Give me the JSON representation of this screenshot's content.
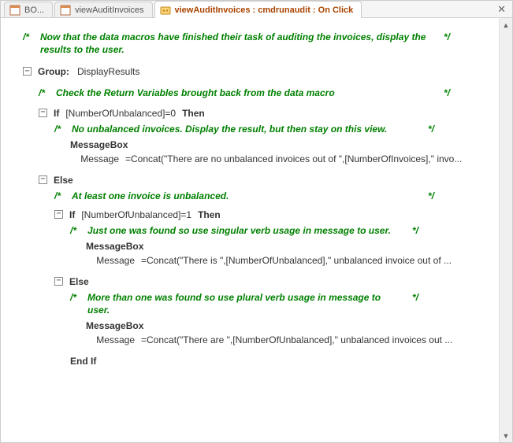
{
  "tabs": {
    "t0": {
      "label": "BO..."
    },
    "t1": {
      "label": "viewAuditInvoices"
    },
    "t2": {
      "label": "viewAuditInvoices : cmdrunaudit : On Click"
    }
  },
  "close_x": "✕",
  "comments": {
    "top": "Now that the data macros have finished their task of auditing the invoices, display the results to the user.",
    "checkrv": "Check the Return Variables brought back from the data macro",
    "nounbal": "No unbalanced invoices. Display the result, but then stay on this view.",
    "atleast": "At least one invoice is unbalanced.",
    "justone": "Just one was found so use singular verb usage in message to user.",
    "plural": "More than one was found so use plural verb usage in message to user."
  },
  "code": {
    "group_kw": "Group:",
    "group_name": "DisplayResults",
    "if_kw": "If",
    "then_kw": "Then",
    "else_kw": "Else",
    "endif_kw": "End If",
    "cond1": "[NumberOfUnbalanced]=0",
    "cond2": "[NumberOfUnbalanced]=1",
    "msgbox": "MessageBox",
    "param_msg": "Message",
    "val1": "=Concat(\"There are no unbalanced invoices out of \",[NumberOfInvoices],\" invo...",
    "val2": "=Concat(\"There is \",[NumberOfUnbalanced],\" unbalanced invoice out of ...",
    "val3": "=Concat(\"There are \",[NumberOfUnbalanced],\" unbalanced invoices out ..."
  },
  "glyphs": {
    "minus": "−",
    "cstart": "/*",
    "cend": "*/"
  }
}
